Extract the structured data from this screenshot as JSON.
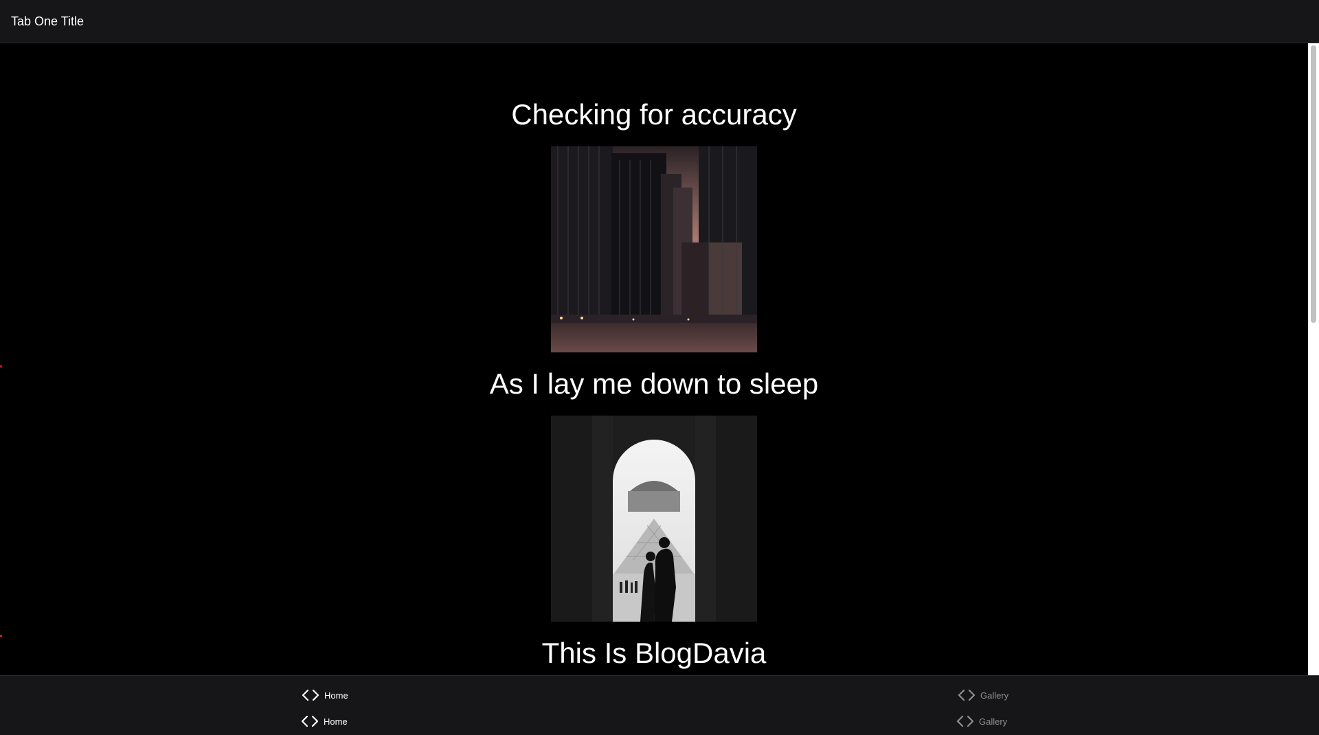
{
  "header": {
    "title": "Tab One Title"
  },
  "posts": [
    {
      "title": "Checking for accuracy",
      "image": "city-skyline-dusk-photo"
    },
    {
      "title": "As I lay me down to sleep",
      "image": "louvre-archway-silhouettes-photo"
    },
    {
      "title": "This Is BlogDavia"
    }
  ],
  "tabbar": {
    "rows": [
      {
        "home": {
          "label": "Home",
          "icon": "code-chevrons-icon"
        },
        "gallery": {
          "label": "Gallery",
          "icon": "code-chevrons-icon"
        }
      },
      {
        "home": {
          "label": "Home",
          "icon": "code-chevrons-icon"
        },
        "gallery": {
          "label": "Gallery",
          "icon": "code-chevrons-icon"
        }
      }
    ],
    "active_color": "#ffffff",
    "inactive_color": "#8e8e93"
  },
  "colors": {
    "background": "#000000",
    "bar_background": "#161618",
    "accent_mark": "#d11a2a"
  }
}
